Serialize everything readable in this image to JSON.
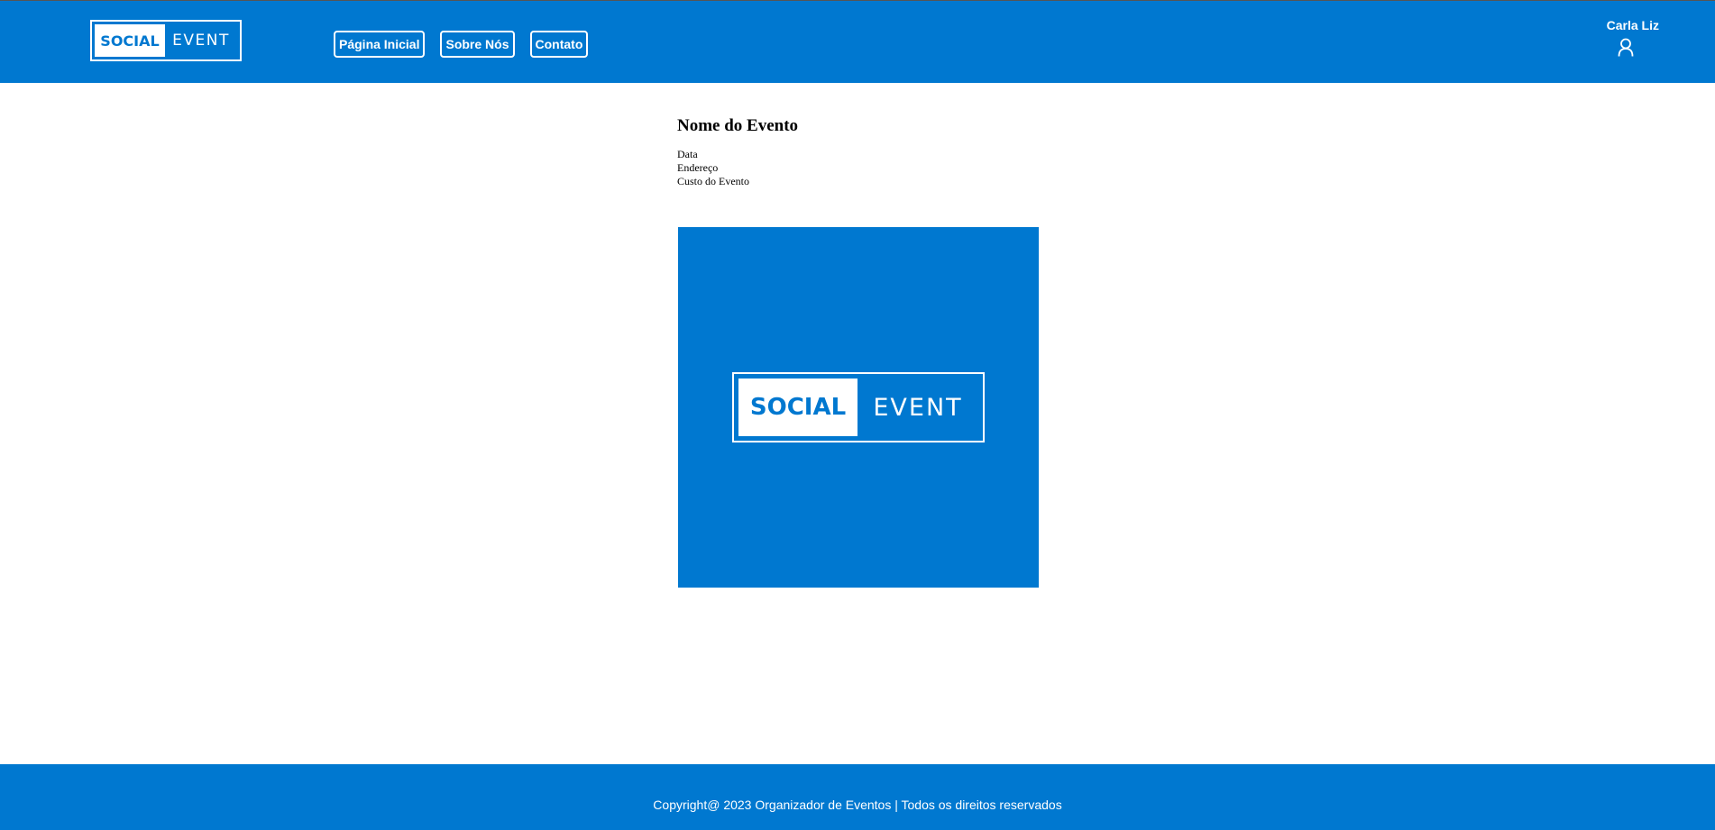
{
  "header": {
    "logo": {
      "left": "SOCIAL",
      "right": "EVENT"
    },
    "nav": [
      {
        "label": "Página Inicial"
      },
      {
        "label": "Sobre Nós"
      },
      {
        "label": "Contato"
      }
    ],
    "user": {
      "name": "Carla Liz",
      "icon": "user-icon"
    }
  },
  "event": {
    "title": "Nome do Evento",
    "date_label": "Data",
    "address_label": "Endereço",
    "cost_label": "Custo do Evento",
    "image_logo": {
      "left": "SOCIAL",
      "right": "EVENT"
    }
  },
  "footer": {
    "text": "Copyright@ 2023 Organizador de Eventos | Todos os direitos reservados"
  },
  "colors": {
    "brand": "#0078d0",
    "text": "#000000",
    "background": "#ffffff"
  }
}
